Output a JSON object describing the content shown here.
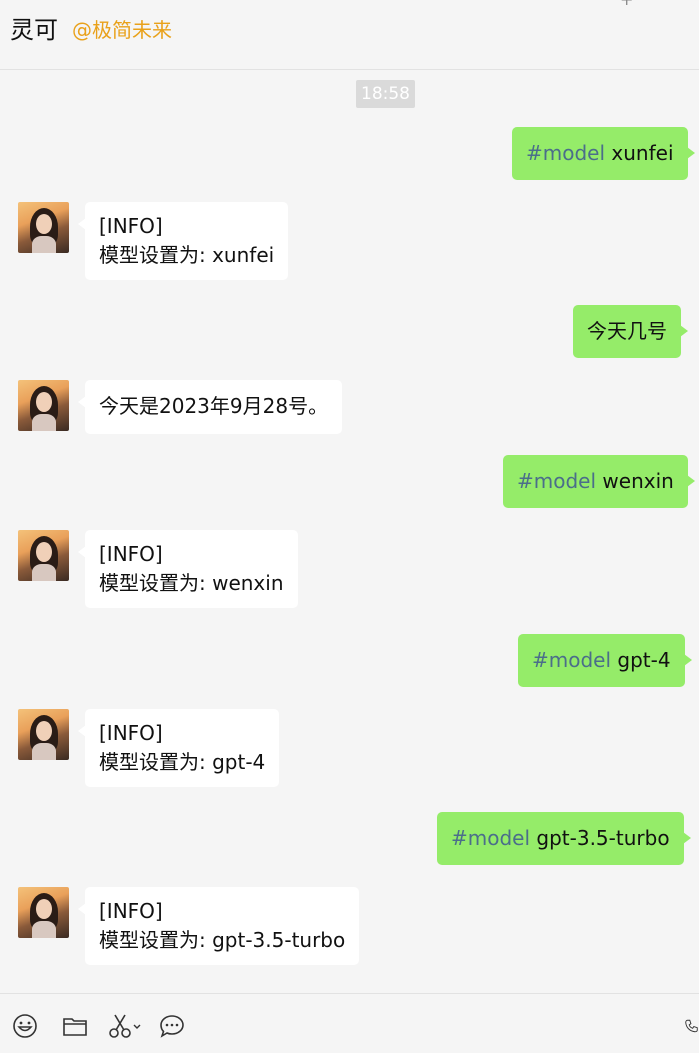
{
  "header": {
    "title": "灵可",
    "subtitle": "@极简未来"
  },
  "timestamp": "18:58",
  "messages": [
    {
      "side": "out",
      "cmd": "#model",
      "text": " xunfei"
    },
    {
      "side": "in",
      "line1": "[INFO]",
      "line2": "模型设置为: xunfei"
    },
    {
      "side": "out",
      "text": "今天几号"
    },
    {
      "side": "in",
      "line1": "今天是2023年9月28号。"
    },
    {
      "side": "out",
      "cmd": "#model",
      "text": " wenxin"
    },
    {
      "side": "in",
      "line1": "[INFO]",
      "line2": "模型设置为: wenxin"
    },
    {
      "side": "out",
      "cmd": "#model",
      "text": " gpt-4"
    },
    {
      "side": "in",
      "line1": "[INFO]",
      "line2": "模型设置为: gpt-4"
    },
    {
      "side": "out",
      "cmd": "#model",
      "text": " gpt-3.5-turbo"
    },
    {
      "side": "in",
      "line1": "[INFO]",
      "line2": "模型设置为: gpt-3.5-turbo"
    }
  ],
  "toolbar": {
    "icons": [
      "emoji-icon",
      "folder-icon",
      "scissors-icon",
      "chat-bubble-icon",
      "phone-icon"
    ]
  }
}
